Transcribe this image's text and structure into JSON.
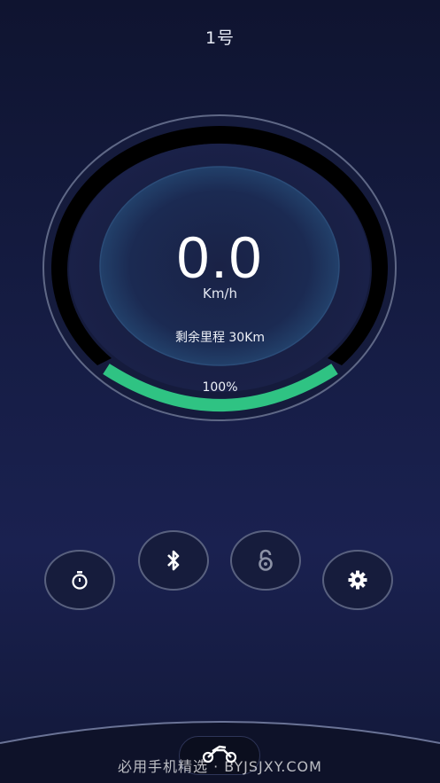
{
  "header": {
    "title": "1号"
  },
  "dashboard": {
    "speed": "0.0",
    "speed_unit": "Km/h",
    "remaining_range": "剩余里程 30Km",
    "battery_percent_text": "100%",
    "battery_level": 1.0,
    "accent_color": "#2fc383"
  },
  "controls": [
    {
      "name": "timer",
      "icon": "stopwatch-icon"
    },
    {
      "name": "bluetooth",
      "icon": "bluetooth-icon"
    },
    {
      "name": "lock",
      "icon": "unlock-icon"
    },
    {
      "name": "settings",
      "icon": "gear-icon"
    }
  ],
  "bottom_bar": {
    "mode_icon": "motorcycle-icon"
  },
  "watermark": "必用手机精选 · BYJSJXY.COM"
}
